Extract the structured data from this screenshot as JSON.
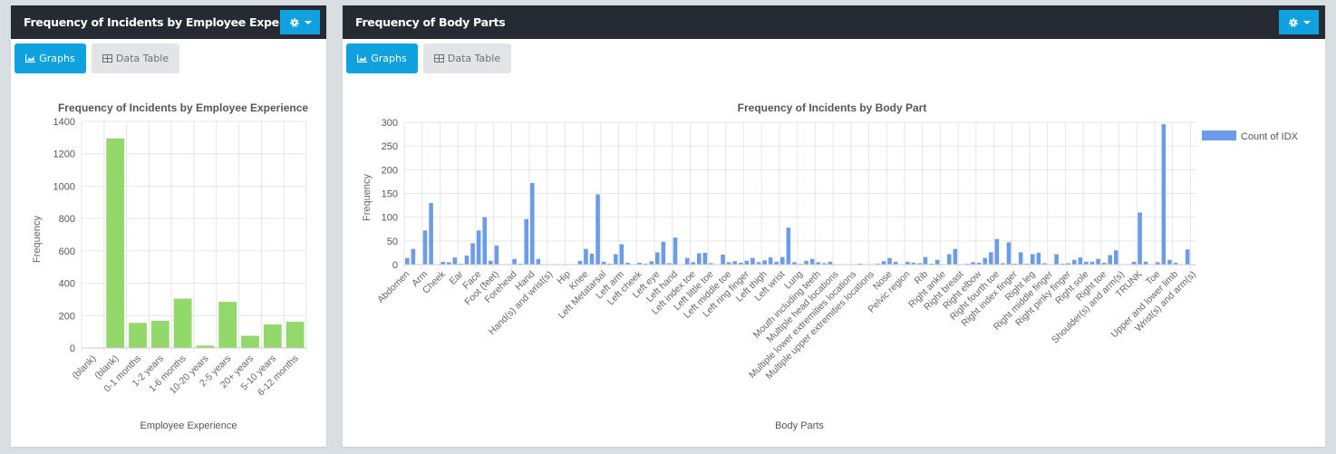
{
  "panels": [
    {
      "title": "Frequency of Incidents by Employee Experience",
      "tabs": {
        "graphs": "Graphs",
        "data_table": "Data Table"
      },
      "settings_icon": "gear-icon"
    },
    {
      "title": "Frequency of Body Parts",
      "tabs": {
        "graphs": "Graphs",
        "data_table": "Data Table"
      },
      "settings_icon": "gear-icon"
    }
  ],
  "colors": {
    "accent": "#0fa2de",
    "header": "#262b33",
    "green_bar": "#92d86b",
    "blue_bar": "#6c9ce6"
  },
  "chart_data": [
    {
      "type": "bar",
      "title": "Frequency of Incidents by Employee Experience",
      "xlabel": "Employee Experience",
      "ylabel": "Frequency",
      "ylim": [
        0,
        1400
      ],
      "yticks": [
        0,
        200,
        400,
        600,
        800,
        1000,
        1200,
        1400
      ],
      "grid": true,
      "categories": [
        "(blank)",
        "(blank)",
        "0-1 months",
        "1-2 years",
        "1-6 months",
        "10-20 years",
        "2-5 years",
        "20+ years",
        "5-10 years",
        "6-12 months"
      ],
      "values": [
        2,
        1295,
        155,
        168,
        305,
        15,
        285,
        75,
        145,
        162
      ]
    },
    {
      "type": "bar",
      "title": "Frequency of Incidents by Body Part",
      "xlabel": "Body Parts",
      "ylabel": "Frequency",
      "ylim": [
        0,
        300
      ],
      "yticks": [
        0,
        50,
        100,
        150,
        200,
        250,
        300
      ],
      "grid": true,
      "legend": {
        "position": "right",
        "entries": [
          "Count of IDX"
        ]
      },
      "tick_labels": [
        "Abdomen",
        "Arm",
        "Cheek",
        "Ear",
        "Face",
        "Foot (feet)",
        "Forehead",
        "Hand",
        "Hand(s) and wrist(s)",
        "Hip",
        "Knee",
        "Left Metatarsal",
        "Left arm",
        "Left cheek",
        "Left eye",
        "Left hand",
        "Left index toe",
        "Left little toe",
        "Left middle toe",
        "Left ring finger",
        "Left thigh",
        "Left wrist",
        "Lung",
        "Mouth including teeth",
        "Multiple head locations",
        "Multiple lower extremities locations",
        "Multiple upper extremities locations",
        "Nose",
        "Pelvic region",
        "Rib",
        "Right ankle",
        "Right breast",
        "Right elbow",
        "Right fourth toe",
        "Right index finger",
        "Right leg",
        "Right middle finger",
        "Right pinky finger",
        "Right sole",
        "Right toe",
        "Shoulder(s) and arm(s)",
        "TRUNK",
        "Toe",
        "Upper and lower limb",
        "Wrist(s) and arm(s)"
      ],
      "bars_per_tick": 3,
      "values": [
        14,
        33,
        1,
        72,
        130,
        1,
        6,
        5,
        15,
        2,
        19,
        45,
        72,
        100,
        8,
        40,
        1,
        1,
        12,
        2,
        96,
        172,
        12,
        1,
        1,
        1,
        1,
        1,
        1,
        8,
        33,
        23,
        148,
        6,
        2,
        22,
        43,
        4,
        1,
        4,
        2,
        7,
        26,
        48,
        3,
        57,
        1,
        14,
        5,
        24,
        25,
        3,
        1,
        21,
        5,
        7,
        4,
        8,
        14,
        5,
        9,
        15,
        6,
        16,
        78,
        5,
        2,
        8,
        12,
        5,
        3,
        6,
        1,
        1,
        1,
        1,
        2,
        1,
        1,
        2,
        7,
        14,
        6,
        1,
        6,
        4,
        3,
        16,
        2,
        10,
        1,
        22,
        33,
        1,
        2,
        5,
        4,
        14,
        26,
        54,
        3,
        47,
        2,
        26,
        2,
        22,
        25,
        3,
        1,
        22,
        2,
        3,
        10,
        15,
        6,
        6,
        12,
        4,
        20,
        30,
        1,
        1,
        6,
        110,
        6,
        1,
        5,
        296,
        10,
        4,
        1,
        32,
        1
      ],
      "series": [
        {
          "name": "Count of IDX"
        }
      ]
    }
  ]
}
